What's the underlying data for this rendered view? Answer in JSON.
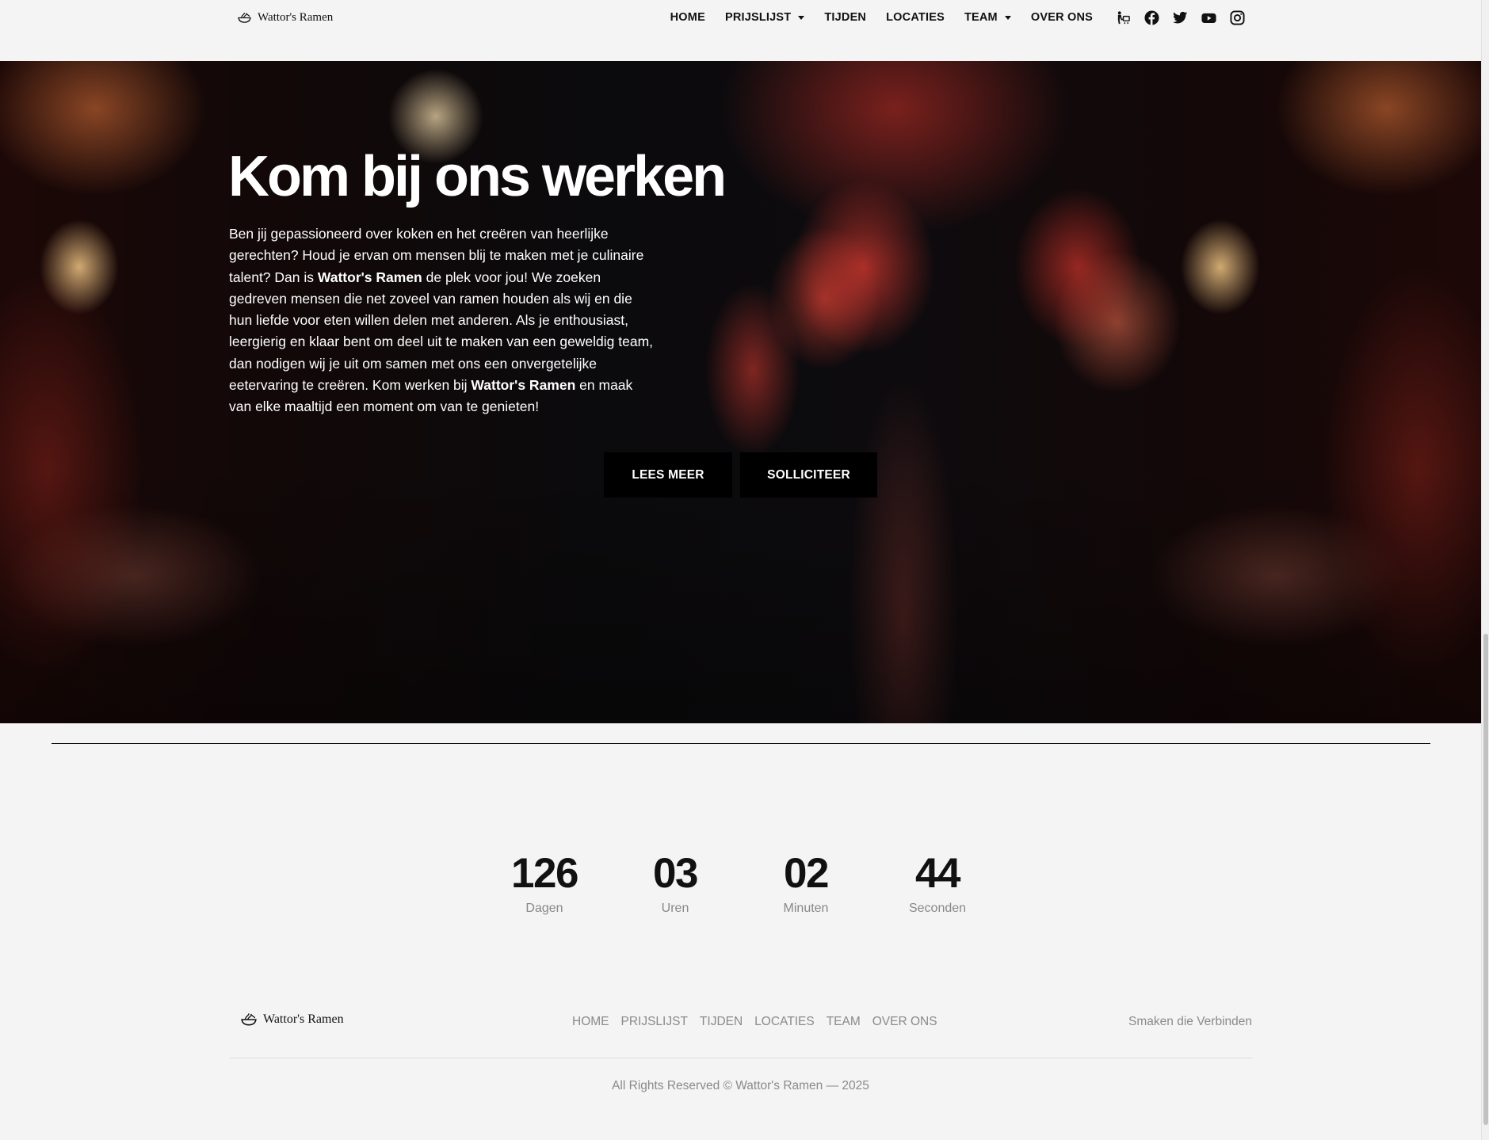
{
  "header": {
    "logo_text": "Wattor's Ramen",
    "nav": [
      {
        "label": "HOME",
        "has_dropdown": false
      },
      {
        "label": "PRIJSLIJST",
        "has_dropdown": true
      },
      {
        "label": "TIJDEN",
        "has_dropdown": false
      },
      {
        "label": "LOCATIES",
        "has_dropdown": false
      },
      {
        "label": "TEAM",
        "has_dropdown": true
      },
      {
        "label": "OVER ONS",
        "has_dropdown": false
      }
    ],
    "social_icons": [
      "takeaway-icon",
      "facebook-icon",
      "twitter-icon",
      "youtube-icon",
      "instagram-icon"
    ]
  },
  "hero": {
    "title": "Kom bij ons werken",
    "paragraph": {
      "p1": "Ben jij gepassioneerd over koken en het creëren van heerlijke gerechten? Houd je ervan om mensen blij te maken met je culinaire talent? Dan is ",
      "brand1": "Wattor's Ramen",
      "p2": " de plek voor jou! We zoeken gedreven mensen die net zoveel van ramen houden als wij en die hun liefde voor eten willen delen met anderen. Als je enthousiast, leergierig en klaar bent om deel uit te maken van een geweldig team, dan nodigen wij je uit om samen met ons een onvergetelijke eetervaring te creëren. Kom werken bij ",
      "brand2": "Wattor's Ramen",
      "p3": " en maak van elke maaltijd een moment om van te genieten!"
    },
    "buttons": {
      "lees_meer": "LEES MEER",
      "solliciteer": "SOLLICITEER"
    }
  },
  "countdown": [
    {
      "value": "126",
      "label": "Dagen"
    },
    {
      "value": "03",
      "label": "Uren"
    },
    {
      "value": "02",
      "label": "Minuten"
    },
    {
      "value": "44",
      "label": "Seconden"
    }
  ],
  "footer": {
    "logo_text": "Wattor's Ramen",
    "links": [
      "HOME",
      "PRIJSLIJST",
      "TIJDEN",
      "LOCATIES",
      "TEAM",
      "OVER ONS"
    ],
    "tagline": "Smaken die Verbinden",
    "copyright": "All Rights Reserved © Wattor's Ramen — 2025"
  },
  "colors": {
    "accent": "#000000",
    "background": "#f4f4f4",
    "muted_text": "#8a8a8a"
  }
}
